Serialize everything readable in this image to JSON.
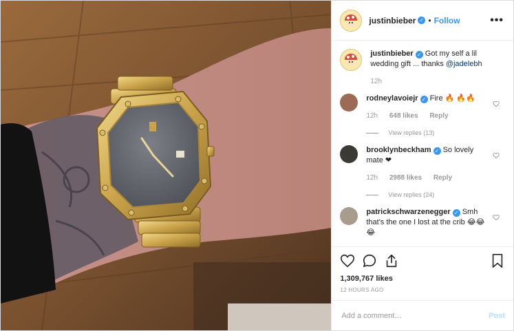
{
  "header": {
    "username": "justinbieber",
    "separator": "•",
    "follow_label": "Follow",
    "more_label": "•••"
  },
  "caption": {
    "username": "justinbieber",
    "text": "Got my self a lil wedding gift ... thanks ",
    "mention": "@jadelebh",
    "time": "12h"
  },
  "comments": [
    {
      "username": "rodneylavoiejr",
      "text": "Fire 🔥 🔥🔥",
      "time": "12h",
      "likes": "648 likes",
      "reply_label": "Reply",
      "view_replies": "View replies (13)"
    },
    {
      "username": "brooklynbeckham",
      "text": "So lovely mate ❤",
      "time": "12h",
      "likes": "2988 likes",
      "reply_label": "Reply",
      "view_replies": "View replies (24)"
    },
    {
      "username": "patrickschwarzenegger",
      "text": "Smh that's the one I lost at the crib 😂😂😂"
    }
  ],
  "engagement": {
    "likes": "1,309,767 likes",
    "posted": "12 HOURS AGO"
  },
  "composer": {
    "placeholder": "Add a comment…",
    "post_label": "Post"
  },
  "icons": {
    "verified": "verified-badge-icon",
    "like": "heart-icon",
    "comment": "comment-bubble-icon",
    "share": "share-icon",
    "save": "bookmark-icon"
  },
  "colors": {
    "accent": "#3897f0",
    "post_disabled": "#b2dffc",
    "muted": "#999999",
    "border": "#dbdbdb"
  }
}
